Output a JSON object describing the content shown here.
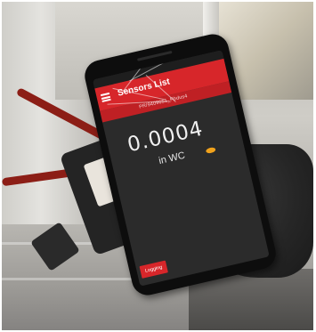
{
  "app": {
    "title": "Sensors List",
    "device_id": "PR/9409651_Pbdus4",
    "reading": "0.0004",
    "unit": "in WC",
    "logging_button": "Logging"
  },
  "colors": {
    "app_bar": "#d7262a",
    "screen_bg": "#2b2b2b",
    "indicator": "#f0a21c"
  },
  "icons": [
    "menu-icon",
    "status-indicator-icon"
  ]
}
